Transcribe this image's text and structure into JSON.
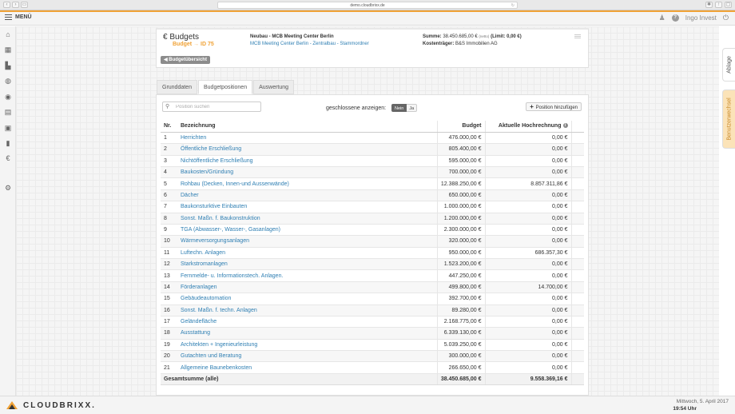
{
  "browser": {
    "url": "demo.cloudbrixx.de"
  },
  "app": {
    "menu_label": "MENÜ",
    "user_name": "Ingo Invest",
    "help_icon": "?",
    "brand": "CLOUDBRIXX.",
    "date": "Mittwoch, 5. April 2017",
    "time": "19:54 Uhr"
  },
  "right_tabs": {
    "ablage": "Ablage",
    "benutzerwechsel": "Benutzerwechsel"
  },
  "header": {
    "title": "Budgets",
    "sub_label": "Budget",
    "sub_arrow": "→",
    "sub_id": "ID 75",
    "project": "Neubau - MCB Meeting Center Berlin",
    "project_link": "MCB Meeting Center Berlin - Zentralbau - Stammordner",
    "sum_label": "Summe:",
    "sum_value": "38.450.685,00 €",
    "sum_netto": "(netto)",
    "limit_text": "(Limit: 0,00 €)",
    "kost_label": "Kostenträger:",
    "kost_value": "B&S Immobilien AG",
    "back_label": "Budgetübersicht"
  },
  "tabs": [
    "Grunddaten",
    "Budgetpositionen",
    "Auswertung"
  ],
  "toolbar": {
    "search_placeholder": "Position suchen",
    "closed_label": "geschlossene anzeigen:",
    "toggle_no": "Nein",
    "toggle_yes": "Ja",
    "add_label": "Position hinzufügen"
  },
  "table": {
    "headers": {
      "nr": "Nr.",
      "name": "Bezeichnung",
      "budget": "Budget",
      "forecast": "Aktuelle Hochrechnung"
    },
    "rows": [
      {
        "nr": "1",
        "name": "Herrichten",
        "budget": "476.000,00 €",
        "forecast": "0,00 €"
      },
      {
        "nr": "2",
        "name": "Öffentliche Erschließung",
        "budget": "805.400,00 €",
        "forecast": "0,00 €"
      },
      {
        "nr": "3",
        "name": "Nichtöffentliche Erschließung",
        "budget": "595.000,00 €",
        "forecast": "0,00 €"
      },
      {
        "nr": "4",
        "name": "Baukosten/Gründung",
        "budget": "700.000,00 €",
        "forecast": "0,00 €"
      },
      {
        "nr": "5",
        "name": "Rohbau (Decken, Innen-und Aussenwände)",
        "budget": "12.388.250,00 €",
        "forecast": "8.857.311,86 €"
      },
      {
        "nr": "6",
        "name": "Dächer",
        "budget": "650.000,00 €",
        "forecast": "0,00 €"
      },
      {
        "nr": "7",
        "name": "Baukonsturktive Einbauten",
        "budget": "1.000.000,00 €",
        "forecast": "0,00 €"
      },
      {
        "nr": "8",
        "name": "Sonst. Maßn. f. Baukonstruktion",
        "budget": "1.200.000,00 €",
        "forecast": "0,00 €"
      },
      {
        "nr": "9",
        "name": "TGA (Abwasser-, Wasser-, Gasanlagen)",
        "budget": "2.300.000,00 €",
        "forecast": "0,00 €"
      },
      {
        "nr": "10",
        "name": "Wärmeversorgungsanlagen",
        "budget": "320.000,00 €",
        "forecast": "0,00 €"
      },
      {
        "nr": "11",
        "name": "Luftechn. Anlagen",
        "budget": "950.000,00 €",
        "forecast": "686.357,30 €"
      },
      {
        "nr": "12",
        "name": "Starkstromanlagen",
        "budget": "1.523.200,00 €",
        "forecast": "0,00 €"
      },
      {
        "nr": "13",
        "name": "Fernmelde- u. Informationstech. Anlagen.",
        "budget": "447.250,00 €",
        "forecast": "0,00 €"
      },
      {
        "nr": "14",
        "name": "Förderanlagen",
        "budget": "499.800,00 €",
        "forecast": "14.700,00 €"
      },
      {
        "nr": "15",
        "name": "Gebäudeautomation",
        "budget": "392.700,00 €",
        "forecast": "0,00 €"
      },
      {
        "nr": "16",
        "name": "Sonst. Maßn. f. techn. Anlagen",
        "budget": "89.280,00 €",
        "forecast": "0,00 €"
      },
      {
        "nr": "17",
        "name": "Geländefläche",
        "budget": "2.168.775,00 €",
        "forecast": "0,00 €"
      },
      {
        "nr": "18",
        "name": "Ausstattung",
        "budget": "6.339.130,00 €",
        "forecast": "0,00 €"
      },
      {
        "nr": "19",
        "name": "Architekten + Ingenieurleistung",
        "budget": "5.039.250,00 €",
        "forecast": "0,00 €"
      },
      {
        "nr": "20",
        "name": "Gutachten und Beratung",
        "budget": "300.000,00 €",
        "forecast": "0,00 €"
      },
      {
        "nr": "21",
        "name": "Allgemeine Baunebenkosten",
        "budget": "266.650,00 €",
        "forecast": "0,00 €"
      }
    ],
    "total": {
      "label": "Gesamtsumme (alle)",
      "budget": "38.450.685,00 €",
      "forecast": "9.558.369,16 €"
    }
  },
  "colors": {
    "accent": "#f0a236",
    "link": "#2f7fb3"
  }
}
